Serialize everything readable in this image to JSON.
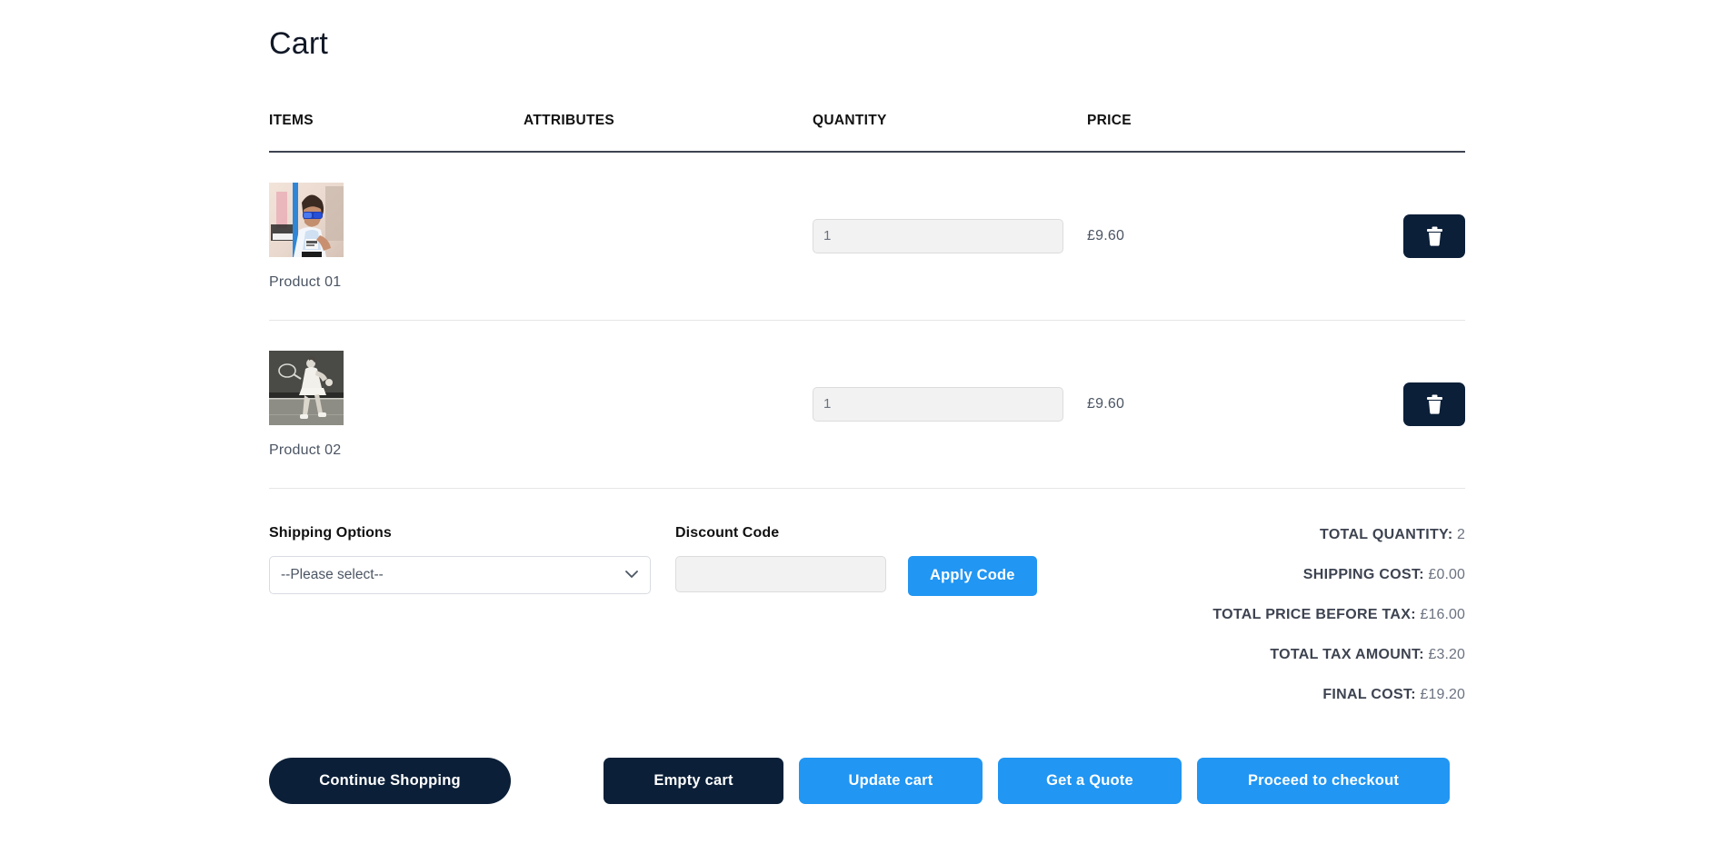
{
  "page": {
    "title": "Cart"
  },
  "table": {
    "headers": {
      "items": "ITEMS",
      "attributes": "ATTRIBUTES",
      "quantity": "QUANTITY",
      "price": "PRICE"
    },
    "rows": [
      {
        "name": "Product 01",
        "image_alt": "athlete-running-photo",
        "attributes": "",
        "quantity": "1",
        "price": "£9.60",
        "remove_icon": "trash-icon"
      },
      {
        "name": "Product 02",
        "image_alt": "tennis-player-photo",
        "attributes": "",
        "quantity": "1",
        "price": "£9.60",
        "remove_icon": "trash-icon"
      }
    ]
  },
  "shipping": {
    "label": "Shipping Options",
    "selected": "--Please select--",
    "chevron_icon": "chevron-down-icon"
  },
  "discount": {
    "label": "Discount Code",
    "value": "",
    "placeholder": "",
    "apply_label": "Apply Code"
  },
  "totals": [
    {
      "label": "TOTAL QUANTITY:",
      "value": "2"
    },
    {
      "label": "SHIPPING COST:",
      "value": "£0.00"
    },
    {
      "label": "TOTAL PRICE BEFORE TAX:",
      "value": "£16.00"
    },
    {
      "label": "TOTAL TAX AMOUNT:",
      "value": "£3.20"
    },
    {
      "label": "FINAL COST:",
      "value": "£19.20"
    }
  ],
  "actions": {
    "continue_shopping": "Continue Shopping",
    "empty_cart": "Empty cart",
    "update_cart": "Update cart",
    "get_quote": "Get a Quote",
    "proceed_checkout": "Proceed to checkout"
  },
  "colors": {
    "primary_blue": "#2196f3",
    "dark_navy": "#0b1f38",
    "muted_text": "#6b7280",
    "header_rule": "#3d4350"
  }
}
